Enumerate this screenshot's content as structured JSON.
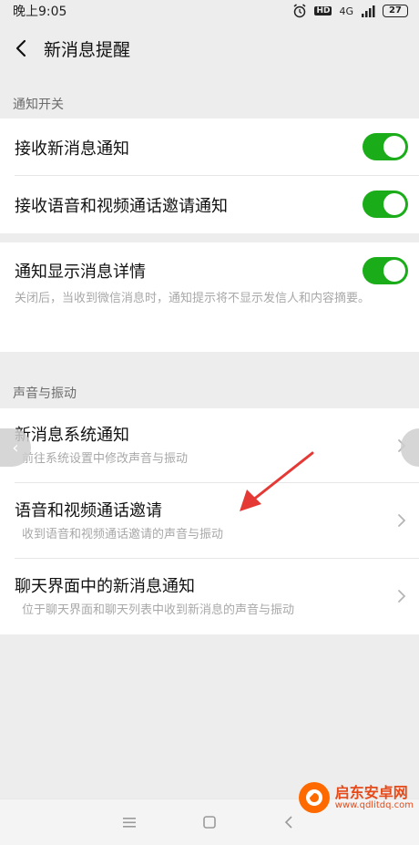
{
  "status_bar": {
    "time": "晚上9:05",
    "network": "4G",
    "battery": "27"
  },
  "header": {
    "title": "新消息提醒"
  },
  "notification_section": {
    "header": "通知开关",
    "items": [
      {
        "label": "接收新消息通知",
        "toggle": "on"
      },
      {
        "label": "接收语音和视频通话邀请通知",
        "toggle": "on"
      }
    ]
  },
  "detail_section": {
    "label": "通知显示消息详情",
    "toggle": "on",
    "description": "关闭后，当收到微信消息时，通知提示将不显示发信人和内容摘要。"
  },
  "sound_section": {
    "header": "声音与振动",
    "items": [
      {
        "label": "新消息系统通知",
        "description": "前往系统设置中修改声音与振动"
      },
      {
        "label": "语音和视频通话邀请",
        "description": "收到语音和视频通话邀请的声音与振动"
      },
      {
        "label": "聊天界面中的新消息通知",
        "description": "位于聊天界面和聊天列表中收到新消息的声音与振动"
      }
    ]
  },
  "watermark": {
    "name": "启东安卓网",
    "url": "www.qdlitdq.com"
  },
  "colors": {
    "toggle_on": "#1aad19",
    "arrow": "#e53935",
    "background": "#ededed"
  }
}
